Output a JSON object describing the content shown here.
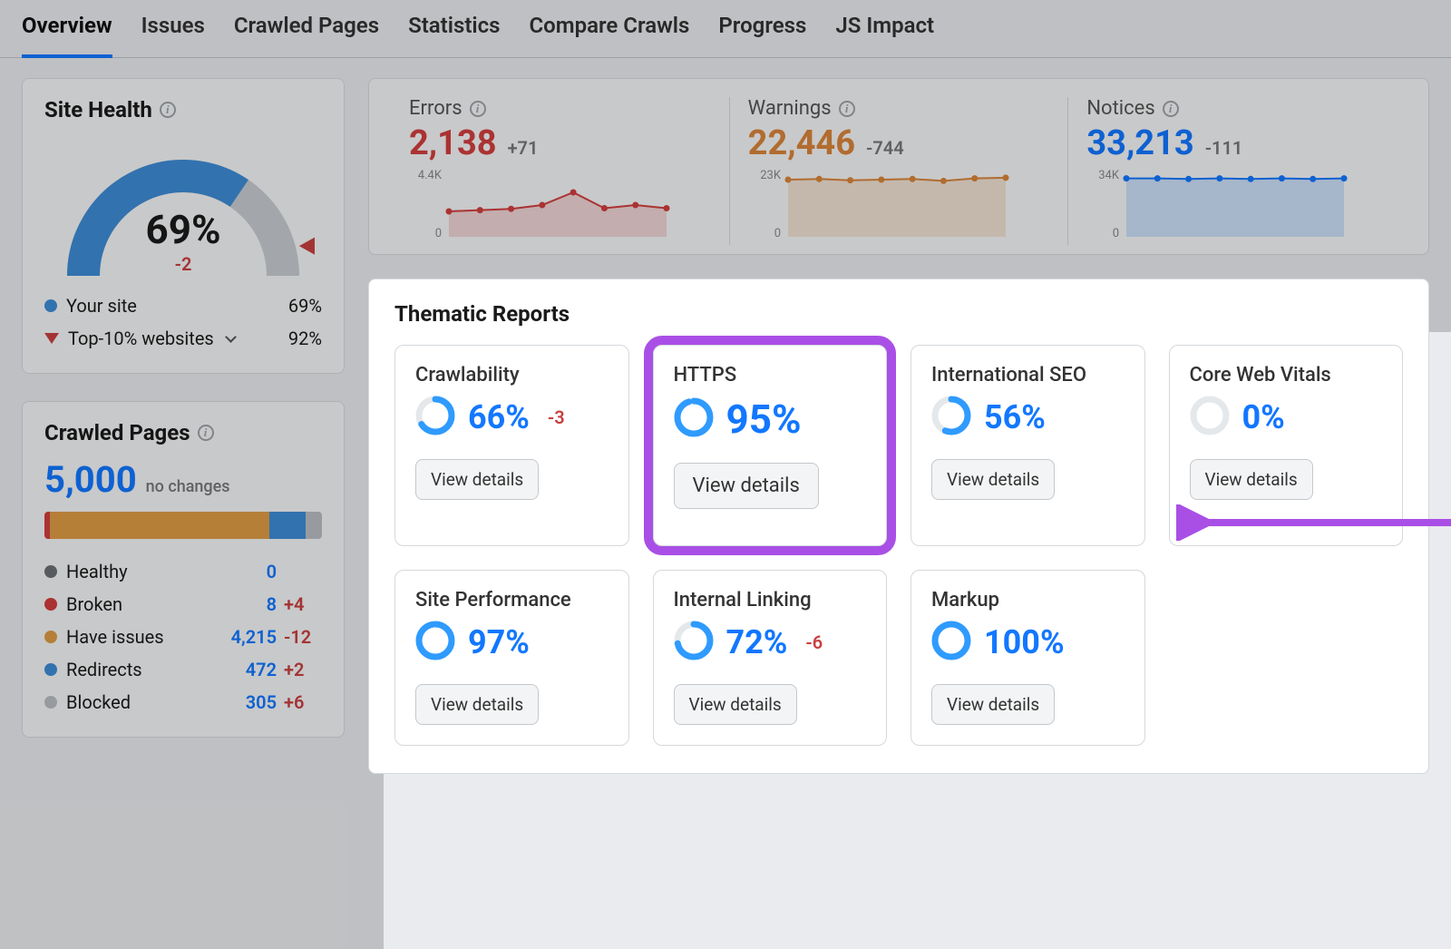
{
  "tabs": [
    "Overview",
    "Issues",
    "Crawled Pages",
    "Statistics",
    "Compare Crawls",
    "Progress",
    "JS Impact"
  ],
  "active_tab": 0,
  "site_health": {
    "title": "Site Health",
    "score": "69%",
    "score_num": 69,
    "delta": "-2",
    "legend": {
      "your_site_label": "Your site",
      "your_site_value": "69%",
      "top10_label": "Top-10% websites",
      "top10_value": "92%"
    },
    "colors": {
      "your_site": "#3d8cd6",
      "remaining": "#c7cbd0"
    }
  },
  "crawled_pages": {
    "title": "Crawled Pages",
    "total": "5,000",
    "subtitle": "no changes",
    "bar_segments": [
      {
        "name": "broken",
        "color": "#d13d3d",
        "pct": 2
      },
      {
        "name": "have_issues",
        "color": "#dd9b45",
        "pct": 79
      },
      {
        "name": "redirects",
        "color": "#3d8cd6",
        "pct": 13
      },
      {
        "name": "blocked",
        "color": "#b9bdc2",
        "pct": 6
      }
    ],
    "rows": [
      {
        "dot": "#6b6f73",
        "label": "Healthy",
        "value": "0",
        "delta": ""
      },
      {
        "dot": "#d13d3d",
        "label": "Broken",
        "value": "8",
        "delta": "+4"
      },
      {
        "dot": "#dd9b45",
        "label": "Have issues",
        "value": "4,215",
        "delta": "-12"
      },
      {
        "dot": "#3d8cd6",
        "label": "Redirects",
        "value": "472",
        "delta": "+2"
      },
      {
        "dot": "#b9bdc2",
        "label": "Blocked",
        "value": "305",
        "delta": "+6"
      }
    ]
  },
  "status_strip": [
    {
      "key": "errors",
      "title": "Errors",
      "value": "2,138",
      "delta": "+71",
      "color": "#d13d3d",
      "y_top": "4.4K",
      "y_bot": "0",
      "points": [
        0.6,
        0.58,
        0.56,
        0.5,
        0.3,
        0.55,
        0.5,
        0.55
      ]
    },
    {
      "key": "warnings",
      "title": "Warnings",
      "value": "22,446",
      "delta": "-744",
      "color": "#d8843a",
      "y_top": "23K",
      "y_bot": "0",
      "points": [
        0.1,
        0.09,
        0.11,
        0.1,
        0.09,
        0.12,
        0.08,
        0.07
      ]
    },
    {
      "key": "notices",
      "title": "Notices",
      "value": "33,213",
      "delta": "-111",
      "color": "#1277ff",
      "y_top": "34K",
      "y_bot": "0",
      "points": [
        0.08,
        0.08,
        0.09,
        0.08,
        0.09,
        0.08,
        0.09,
        0.08
      ]
    }
  ],
  "thematic": {
    "title": "Thematic Reports",
    "button_label": "View details",
    "reports": [
      {
        "name": "Crawlability",
        "pct": 66,
        "pct_label": "66%",
        "delta": "-3",
        "highlight": false
      },
      {
        "name": "HTTPS",
        "pct": 95,
        "pct_label": "95%",
        "delta": "",
        "highlight": true
      },
      {
        "name": "International SEO",
        "pct": 56,
        "pct_label": "56%",
        "delta": "",
        "highlight": false
      },
      {
        "name": "Core Web Vitals",
        "pct": 0,
        "pct_label": "0%",
        "delta": "",
        "highlight": false
      },
      {
        "name": "Site Performance",
        "pct": 97,
        "pct_label": "97%",
        "delta": "",
        "highlight": false
      },
      {
        "name": "Internal Linking",
        "pct": 72,
        "pct_label": "72%",
        "delta": "-6",
        "highlight": false
      },
      {
        "name": "Markup",
        "pct": 100,
        "pct_label": "100%",
        "delta": "",
        "highlight": false
      }
    ]
  },
  "chart_data": {
    "gauge": {
      "type": "gauge",
      "value": 69,
      "max": 100,
      "delta": -2,
      "series": [
        {
          "name": "Your site",
          "value": 69,
          "color": "#3d8cd6"
        },
        {
          "name": "Top-10% websites",
          "value": 92,
          "color": "#c94040"
        }
      ]
    },
    "sparklines": [
      {
        "name": "Errors",
        "type": "area",
        "ylim": [
          0,
          4400
        ],
        "values_rel": [
          0.6,
          0.58,
          0.56,
          0.5,
          0.3,
          0.55,
          0.5,
          0.55
        ],
        "color": "#d13d3d"
      },
      {
        "name": "Warnings",
        "type": "area",
        "ylim": [
          0,
          23000
        ],
        "values_rel": [
          0.1,
          0.09,
          0.11,
          0.1,
          0.09,
          0.12,
          0.08,
          0.07
        ],
        "color": "#d8843a"
      },
      {
        "name": "Notices",
        "type": "area",
        "ylim": [
          0,
          34000
        ],
        "values_rel": [
          0.08,
          0.08,
          0.09,
          0.08,
          0.09,
          0.08,
          0.09,
          0.08
        ],
        "color": "#1277ff"
      }
    ],
    "crawled_pages_bar": {
      "type": "bar",
      "total": 5000,
      "series": [
        {
          "name": "Healthy",
          "value": 0
        },
        {
          "name": "Broken",
          "value": 8
        },
        {
          "name": "Have issues",
          "value": 4215
        },
        {
          "name": "Redirects",
          "value": 472
        },
        {
          "name": "Blocked",
          "value": 305
        }
      ]
    },
    "thematic_donuts": {
      "type": "donut",
      "series": [
        {
          "name": "Crawlability",
          "value": 66
        },
        {
          "name": "HTTPS",
          "value": 95
        },
        {
          "name": "International SEO",
          "value": 56
        },
        {
          "name": "Core Web Vitals",
          "value": 0
        },
        {
          "name": "Site Performance",
          "value": 97
        },
        {
          "name": "Internal Linking",
          "value": 72
        },
        {
          "name": "Markup",
          "value": 100
        }
      ]
    }
  }
}
